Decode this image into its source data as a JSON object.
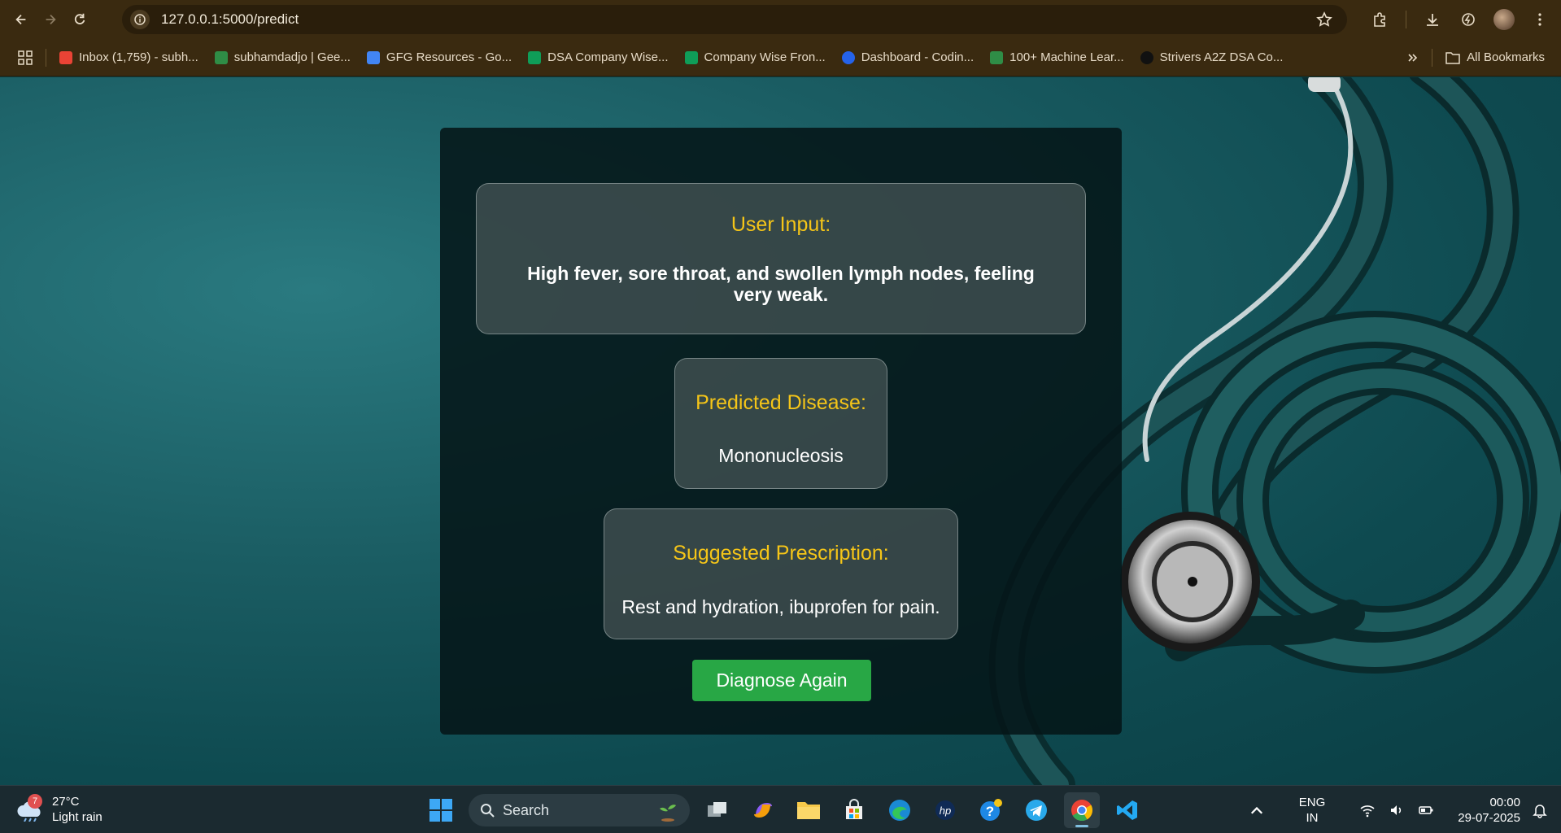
{
  "browser": {
    "url": "127.0.0.1:5000/predict",
    "bookmarks": [
      {
        "label": "Inbox (1,759) - subh...",
        "icon": "gmail-icon",
        "color": "#ea4335"
      },
      {
        "label": "subhamdadjo | Gee...",
        "icon": "gfg-icon",
        "color": "#2f8d46"
      },
      {
        "label": "GFG Resources - Go...",
        "icon": "google-docs-icon",
        "color": "#4285f4"
      },
      {
        "label": "DSA Company Wise...",
        "icon": "google-sheets-icon",
        "color": "#0f9d58"
      },
      {
        "label": "Company Wise Fron...",
        "icon": "google-sheets-icon",
        "color": "#0f9d58"
      },
      {
        "label": "Dashboard - Codin...",
        "icon": "codolio-icon",
        "color": "#2563eb"
      },
      {
        "label": "100+ Machine Lear...",
        "icon": "gfg-icon",
        "color": "#2f8d46"
      },
      {
        "label": "Strivers A2Z DSA Co...",
        "icon": "tuf-icon",
        "color": "#111111"
      }
    ],
    "all_bookmarks": "All Bookmarks"
  },
  "result": {
    "input_label": "User Input:",
    "input_text": "High fever, sore throat, and swollen lymph nodes, feeling very weak.",
    "disease_label": "Predicted Disease:",
    "disease": "Mononucleosis",
    "prescription_label": "Suggested Prescription:",
    "prescription": "Rest and hydration, ibuprofen for pain.",
    "button": "Diagnose Again"
  },
  "taskbar": {
    "weather_badge": "7",
    "temperature": "27°C",
    "condition": "Light rain",
    "search": "Search",
    "lang1": "ENG",
    "lang2": "IN",
    "time": "00:00",
    "date": "29-07-2025"
  },
  "colors": {
    "accent_label": "#f5c518",
    "button": "#28a745",
    "chrome": "#3a2a10"
  }
}
